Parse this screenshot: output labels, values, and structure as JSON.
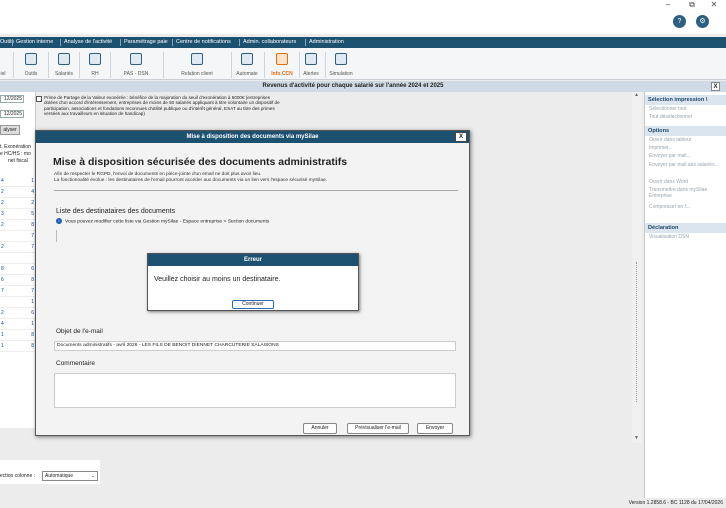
{
  "window": {
    "minimize": "–",
    "maximize": "⧉",
    "close": "✕"
  },
  "menu": [
    "Outils",
    "Gestion interne",
    "Analyse de l'activité",
    "Paramétrage paie",
    "Centre de notifications",
    "Admin. collaborateurs",
    "Administration"
  ],
  "ribbon": [
    "Paramétrage Portail",
    "Outils",
    "Salariés",
    "RH",
    "PAS - DSN",
    "Relation client",
    "Automate",
    "Info CCN",
    "Alertes",
    "Simulation"
  ],
  "ribbon_left": "iel",
  "band_title": "Revenus d'activité pour chaque salarié sur l'année 2024 et 2025",
  "band_close": "X",
  "left": {
    "date1": "12/2025",
    "date2": "12/2025",
    "button": "alyser",
    "labels": [
      "t. Exonération",
      "e HC/HS : mo",
      "net fiscal"
    ],
    "rows": [
      [
        "4",
        "1"
      ],
      [
        "2",
        "4"
      ],
      [
        "2",
        "2"
      ],
      [
        "3",
        "5"
      ],
      [
        "2",
        "8"
      ],
      [
        "",
        "7"
      ],
      [
        "2",
        "7"
      ],
      [
        "",
        ""
      ],
      [
        "8",
        "6"
      ],
      [
        "6",
        "8"
      ],
      [
        "7",
        "7"
      ],
      [
        "",
        "1"
      ],
      [
        "2",
        "6"
      ],
      [
        "4",
        "1"
      ],
      [
        "1",
        "8"
      ],
      [
        "1",
        "8"
      ]
    ]
  },
  "prime_text": "Prime de Partage de la Valeur exonérée : bénéfice de la majoration du seuil d'exonération à 6000€ (entreprises dotées d'un accord d'intéressement, entreprises de moins de 50 salariés appliquant à titre volontaire un dispositif de participation, associations et fondations reconnues d'utilité publique ou d'intérêt général, ESAT au titre des primes versées aux travailleurs en situation de handicap)",
  "right_panel": {
    "sec1": "Sélection impression \\",
    "sec1_items": [
      "Sélectionner tout",
      "Tout désélectionner"
    ],
    "sec2": "Options",
    "sec2_items": [
      "Ouvrir dans tableur",
      "Imprimer...",
      "Envoyer par mail...",
      "Envoyer par mail aux salariés...",
      "Ouvrir dans Word",
      "Transmettre dans mySilae Entreprise",
      "Compresser en f..."
    ],
    "sec3": "Déclaration",
    "sec3_items": [
      "Visualisation DSN"
    ]
  },
  "bottom": {
    "col_label": "ection colonne :",
    "col_value": "Automatique"
  },
  "version": "Version 1.2858.6 - BC 1128 du 17/04/2026",
  "modal": {
    "header": "Mise à disposition des documents via mySilae",
    "close": "X",
    "title": "Mise à disposition sécurisée des documents administratifs",
    "desc1": "Afin de respecter le RGPD, l'envoi de documents en pièce-jointe d'un email ne doit plus avoir lieu.",
    "desc2": "La fonctionnalité évolue : les destinataires de l'email pourront accéder aux documents via un lien vers l'espace sécurisé mySilae.",
    "recipients_label": "Liste des destinataires des documents",
    "info": "Vous pouvez modifier cette liste via Gestion mySilae - Espace entreprise > Section documents",
    "subject_label": "Objet de l'e-mail",
    "subject_value": "Documents administratifs - avril 2026 - LES FILS DE BENOIT DIENNET CHARCUTERIE SALAISONS",
    "comment_label": "Commentaire",
    "btn_cancel": "Annuler",
    "btn_preview": "Prévisualiser l'e-mail",
    "btn_send": "Envoyer"
  },
  "error": {
    "header": "Erreur",
    "message": "Veuillez choisir au moins un destinataire.",
    "button": "Continuer"
  }
}
